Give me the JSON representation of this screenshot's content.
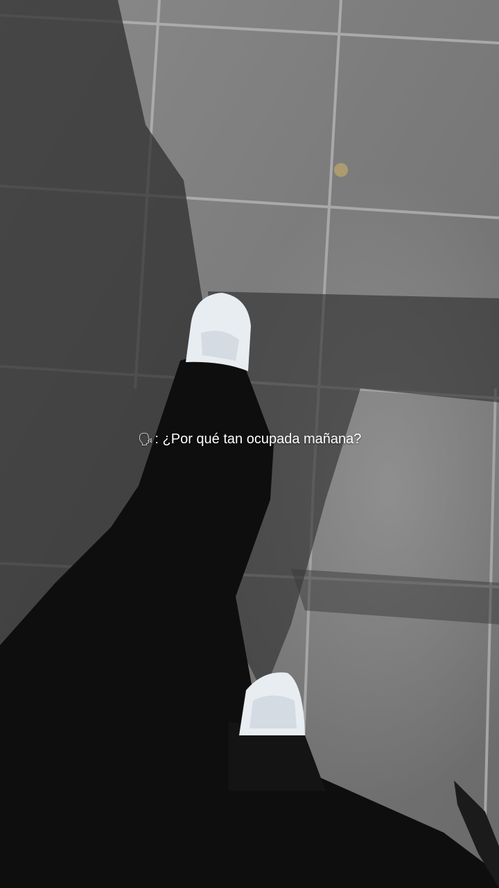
{
  "caption": {
    "icon": "speaking-head-icon",
    "icon_glyph": "🗣",
    "text": ": ¿Por qué tan ocupada mañana?"
  },
  "colors": {
    "ground": "#7b7b7b",
    "grout": "#b9b9b9",
    "pants": "#0f0f0f",
    "shoe": "#e9eef3",
    "caption_text": "#ffffff"
  }
}
